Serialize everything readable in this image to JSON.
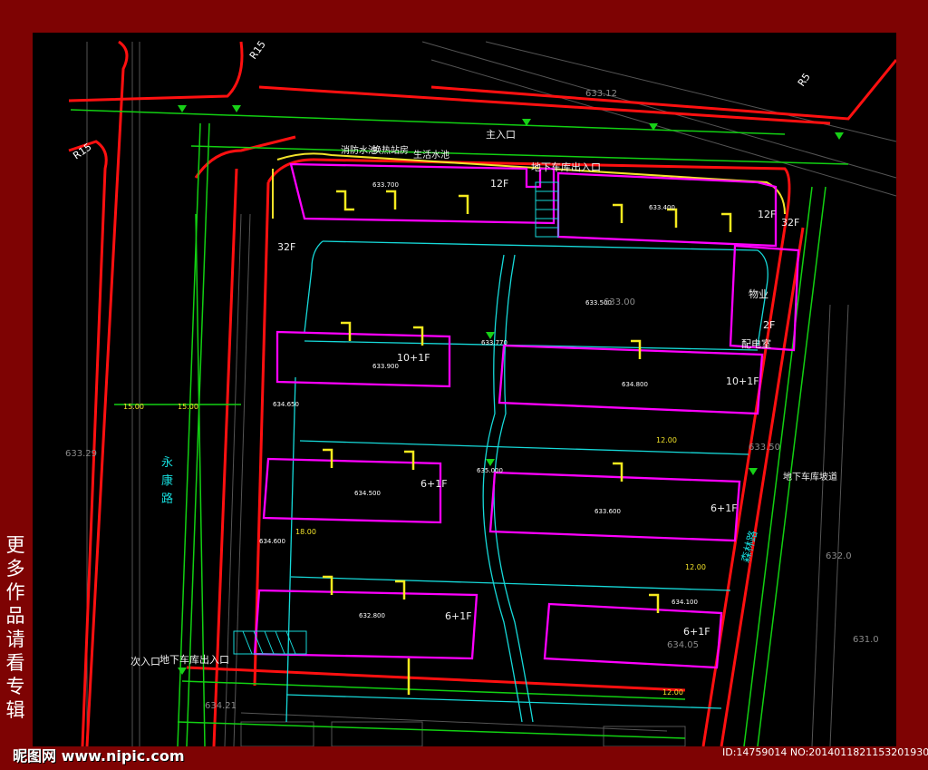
{
  "side_text": [
    "更",
    "多",
    "作",
    "品",
    "请",
    "看",
    "专",
    "辑"
  ],
  "watermark": "昵图网 www.nipic.com",
  "image_id": "ID:14759014 NO:20140118211532019303",
  "labels": {
    "road_yongkang_1": "永",
    "road_yongkang_2": "康",
    "road_yongkang_3": "路",
    "main_entrance": "主入口",
    "secondary_entrance": "次入口",
    "garage_entrance_top": "地下车库出入口",
    "garage_entrance_bottom": "地下车库出入口",
    "fire_pool": "消防水池",
    "pump_room": "换热站房",
    "domestic_water": "生活水池",
    "property": "物业",
    "power_room": "配电室",
    "garage_vent": "地下车库坡道",
    "ring_road": "森林路",
    "r15_left": "R15",
    "r15_top": "R15",
    "r15_right": "R5"
  },
  "floors": {
    "b1": "12F",
    "b2": "12F",
    "b3": "32F",
    "b4": "10+1F",
    "b5": "10+1F",
    "b6": "6+1F",
    "b7": "6+1F",
    "b8": "6+1F",
    "b9": "6+1F",
    "prop": "2F",
    "b1b": "32F"
  },
  "elevations": {
    "e1": "633.700",
    "e2": "633.400",
    "e3": "633.500",
    "e4": "634.650",
    "e5": "634.600",
    "e6": "633.770",
    "e7": "633.900",
    "e8": "634.800",
    "e9": "635.000",
    "e10": "634.500",
    "e11": "633.600",
    "e12": "632.800",
    "e13": "634.100"
  },
  "dims": {
    "d1": "15.00",
    "d2": "12.00",
    "d3": "18.00",
    "d4": "15.00",
    "d5": "12.00",
    "d6": "12.00"
  },
  "grid": {
    "g1": "633.12",
    "g2": "633.00",
    "g3": "633.50",
    "g4": "632.0",
    "g5": "631.0",
    "g6": "634.21",
    "g7": "633.29",
    "g8": "634.05"
  }
}
